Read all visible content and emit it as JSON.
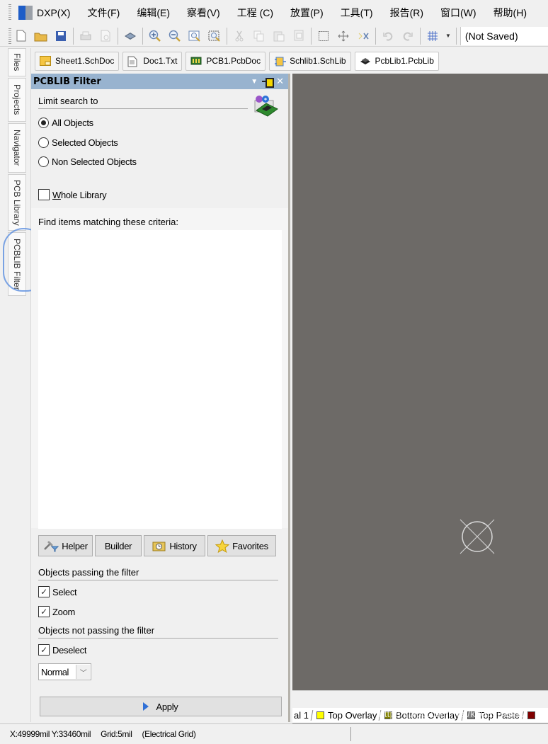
{
  "menu": {
    "items": [
      "DXP(X)",
      "文件(F)",
      "编辑(E)",
      "察看(V)",
      "工程 (C)",
      "放置(P)",
      "工具(T)",
      "报告(R)",
      "窗口(W)",
      "帮助(H)"
    ]
  },
  "toolbar": {
    "icons": [
      "new-document-icon",
      "open-folder-icon",
      "save-icon",
      "print-icon",
      "print-preview-icon",
      "3d-chip-icon",
      "zoom-in-icon",
      "zoom-out-icon",
      "zoom-fit-icon",
      "zoom-selected-icon",
      "cut-icon",
      "copy-icon",
      "paste-icon",
      "rubber-stamp-icon",
      "select-rectangle-icon",
      "move-icon",
      "deselect-icon",
      "undo-icon",
      "redo-icon",
      "grid-icon"
    ],
    "variant_value": "(Not Saved)"
  },
  "side_tabs": [
    "Files",
    "Projects",
    "Navigator",
    "PCB Library",
    "PCBLIB Filter"
  ],
  "doc_tabs": [
    {
      "label": "Sheet1.SchDoc",
      "icon": "schematic-doc-icon"
    },
    {
      "label": "Doc1.Txt",
      "icon": "text-doc-icon"
    },
    {
      "label": "PCB1.PcbDoc",
      "icon": "pcb-doc-icon"
    },
    {
      "label": "Schlib1.SchLib",
      "icon": "schlib-icon"
    },
    {
      "label": "PcbLib1.PcbLib",
      "icon": "pcblib-icon",
      "active": true
    }
  ],
  "panel": {
    "title": "PCBLIB Filter",
    "limit_label": "Limit search to",
    "radios": [
      {
        "label": "All Objects",
        "selected": true
      },
      {
        "label": "Selected Objects",
        "selected": false
      },
      {
        "label": "Non Selected Objects",
        "selected": false
      }
    ],
    "whole_library": {
      "label_underlined": "W",
      "label_rest": "hole Library",
      "checked": false
    },
    "criteria_label": "Find items matching these criteria:",
    "criteria_value": "",
    "buttons": {
      "helper": "Helper",
      "builder": "Builder",
      "history": "History",
      "favorites": "Favorites"
    },
    "passing_label": "Objects passing the filter",
    "select": {
      "label": "Select",
      "checked": true
    },
    "zoom": {
      "label": "Zoom",
      "checked": true
    },
    "not_passing_label": "Objects not passing the filter",
    "deselect": {
      "label": "Deselect",
      "checked": true
    },
    "mask_mode": "Normal",
    "apply": "Apply"
  },
  "layers": [
    {
      "label": "al 1",
      "color": null
    },
    {
      "label": "Top Overlay",
      "color": "#ffff00"
    },
    {
      "label": "Bottom Overlay",
      "color": "#808000"
    },
    {
      "label": "Top Paste",
      "color": "#808080"
    },
    {
      "label": "",
      "color": "#800000"
    }
  ],
  "status": {
    "coords": "X:49999mil Y:33460mil",
    "grid": "Grid:5mil",
    "grid_type": "(Electrical Grid)"
  },
  "watermark": "https://blog.csdn.net/k903161661"
}
